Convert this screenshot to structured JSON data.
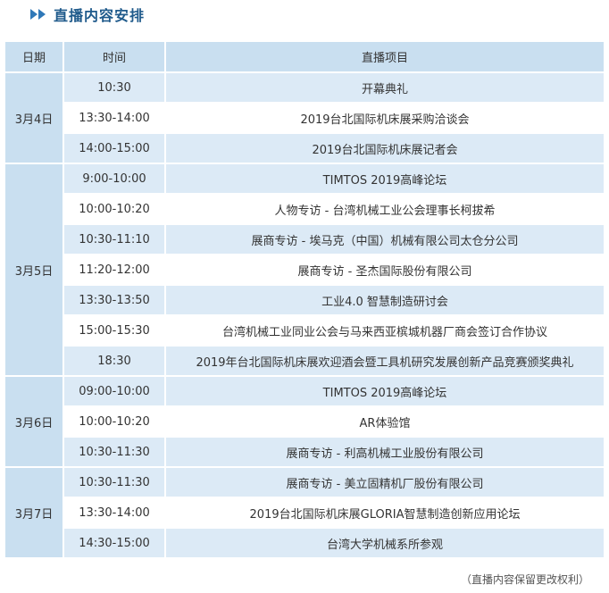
{
  "header": {
    "title": "直播内容安排"
  },
  "table": {
    "columns": [
      "日期",
      "时间",
      "直播项目"
    ],
    "days": [
      {
        "date": "3月4日",
        "rows": [
          {
            "time": "10:30",
            "event": "开幕典礼"
          },
          {
            "time": "13:30-14:00",
            "event": "2019台北国际机床展采购洽谈会"
          },
          {
            "time": "14:00-15:00",
            "event": "2019台北国际机床展记者会"
          }
        ]
      },
      {
        "date": "3月5日",
        "rows": [
          {
            "time": "9:00-10:00",
            "event": "TIMTOS 2019高峰论坛"
          },
          {
            "time": "10:00-10:20",
            "event": "人物专访 - 台湾机械工业公会理事长柯拔希"
          },
          {
            "time": "10:30-11:10",
            "event": "展商专访 - 埃马克（中国）机械有限公司太仓分公司"
          },
          {
            "time": "11:20-12:00",
            "event": "展商专访 - 圣杰国际股份有限公司"
          },
          {
            "time": "13:30-13:50",
            "event": "工业4.0 智慧制造研讨会"
          },
          {
            "time": "15:00-15:30",
            "event": "台湾机械工业同业公会与马来西亚槟城机器厂商会签订合作协议"
          },
          {
            "time": "18:30",
            "event": "2019年台北国际机床展欢迎酒会暨工具机研究发展创新产品竞赛颁奖典礼"
          }
        ]
      },
      {
        "date": "3月6日",
        "rows": [
          {
            "time": "09:00-10:00",
            "event": "TIMTOS 2019高峰论坛"
          },
          {
            "time": "10:00-10:20",
            "event": "AR体验馆"
          },
          {
            "time": "10:30-11:30",
            "event": "展商专访 - 利高机械工业股份有限公司"
          }
        ]
      },
      {
        "date": "3月7日",
        "rows": [
          {
            "time": "10:30-11:30",
            "event": "展商专访 - 美立固精机厂股份有限公司"
          },
          {
            "time": "13:30-14:00",
            "event": "2019台北国际机床展GLORIA智慧制造创新应用论坛"
          },
          {
            "time": "14:30-15:00",
            "event": "台湾大学机械系所参观"
          }
        ]
      }
    ]
  },
  "footnote": "（直播内容保留更改权利）",
  "colors": {
    "title": "#1f5a8b",
    "header_bg": "#c9dff0",
    "row_alt_bg": "#dceaf6",
    "icon": "#2f78b8"
  }
}
